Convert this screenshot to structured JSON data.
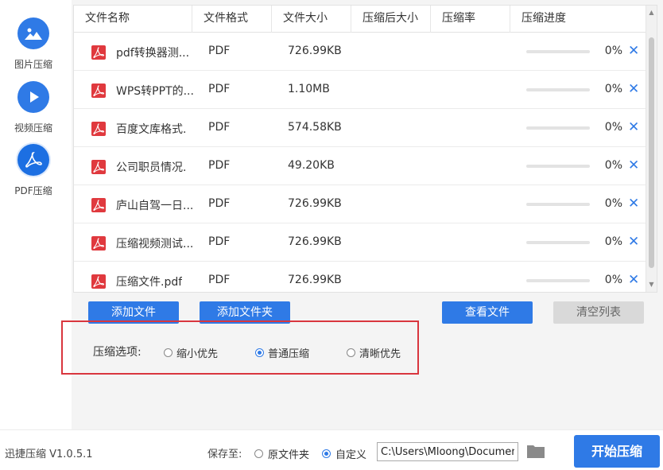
{
  "sidebar": {
    "items": [
      {
        "label": "图片压缩",
        "icon": "image-icon"
      },
      {
        "label": "视频压缩",
        "icon": "play-icon"
      },
      {
        "label": "PDF压缩",
        "icon": "pdf-icon"
      }
    ]
  },
  "table": {
    "headers": [
      "文件名称",
      "文件格式",
      "文件大小",
      "压缩后大小",
      "压缩率",
      "压缩进度"
    ],
    "rows": [
      {
        "name": "pdf转换器测...",
        "type": "PDF",
        "size": "726.99KB",
        "compressed": "",
        "rate": "",
        "progress": "0%",
        "progress_value": 0
      },
      {
        "name": "WPS转PPT的...",
        "type": "PDF",
        "size": "1.10MB",
        "compressed": "",
        "rate": "",
        "progress": "0%",
        "progress_value": 0
      },
      {
        "name": "百度文库格式.",
        "type": "PDF",
        "size": "574.58KB",
        "compressed": "",
        "rate": "",
        "progress": "0%",
        "progress_value": 0
      },
      {
        "name": "公司职员情况.",
        "type": "PDF",
        "size": "49.20KB",
        "compressed": "",
        "rate": "",
        "progress": "0%",
        "progress_value": 0
      },
      {
        "name": "庐山自驾一日...",
        "type": "PDF",
        "size": "726.99KB",
        "compressed": "",
        "rate": "",
        "progress": "0%",
        "progress_value": 0
      },
      {
        "name": "压缩视频测试...",
        "type": "PDF",
        "size": "726.99KB",
        "compressed": "",
        "rate": "",
        "progress": "0%",
        "progress_value": 0
      },
      {
        "name": "压缩文件.pdf",
        "type": "PDF",
        "size": "726.99KB",
        "compressed": "",
        "rate": "",
        "progress": "0%",
        "progress_value": 0
      }
    ],
    "delete_glyph": "✕"
  },
  "actions": {
    "add_file": "添加文件",
    "add_folder": "添加文件夹",
    "view_file": "查看文件",
    "clear_list": "清空列表"
  },
  "options": {
    "label": "压缩选项:",
    "choices": [
      {
        "label": "缩小优先",
        "selected": false
      },
      {
        "label": "普通压缩",
        "selected": true
      },
      {
        "label": "清晰优先",
        "selected": false
      }
    ]
  },
  "bottom": {
    "version": "迅捷压缩 V1.0.5.1",
    "save_label": "保存至:",
    "save_choices": [
      {
        "label": "原文件夹",
        "selected": false
      },
      {
        "label": "自定义",
        "selected": true
      }
    ],
    "path_value": "C:\\Users\\Mloong\\Documents",
    "start_button": "开始压缩"
  },
  "colors": {
    "accent": "#2f7ae6",
    "highlight_border": "#d9363e",
    "pdf_red": "#e0393e"
  }
}
